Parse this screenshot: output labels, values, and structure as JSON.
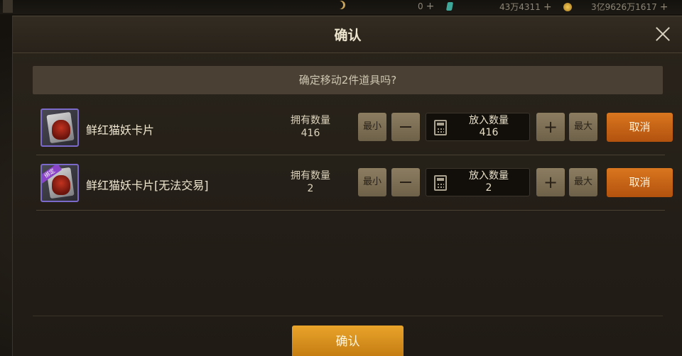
{
  "hud": {
    "value_1": "0",
    "value_2": "43万4311",
    "value_3": "3亿9626万1617"
  },
  "dialog": {
    "title": "确认",
    "question": "确定移动2件道具吗?",
    "confirm_label": "确认"
  },
  "labels": {
    "owned_label": "拥有数量",
    "put_label": "放入数量",
    "min": "最小",
    "max": "最大",
    "cancel": "取消",
    "plus": "+"
  },
  "items": [
    {
      "name": "鲜红猫妖卡片",
      "owned": "416",
      "put": "416",
      "tag": ""
    },
    {
      "name": "鲜红猫妖卡片[无法交易]",
      "owned": "2",
      "put": "2",
      "tag": "绑定"
    }
  ],
  "colors": {
    "accent_orange": "#c96514",
    "confirm_gold": "#d8901e",
    "frame_purple": "#7c6acb"
  }
}
